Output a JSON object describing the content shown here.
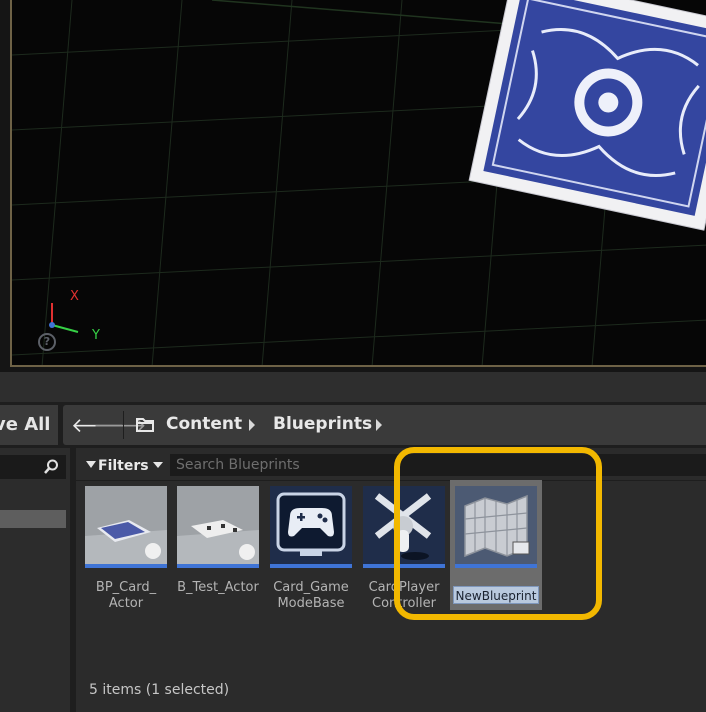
{
  "toolbar": {
    "save_all_label": "ve All"
  },
  "navigation": {
    "back_icon": "arrow-left-icon",
    "forward_icon": "arrow-right-icon",
    "breadcrumb": [
      "Content",
      "Blueprints"
    ]
  },
  "viewport": {
    "axis_x_label": "X",
    "axis_y_label": "Y",
    "help_icon": "?"
  },
  "content_browser": {
    "filters_label": "Filters",
    "search_placeholder": "Search Blueprints",
    "assets": [
      {
        "line1": "BP_Card_",
        "line2": "Actor"
      },
      {
        "line1": "B_Test_Actor",
        "line2": ""
      },
      {
        "line1": "Card_Game",
        "line2": "ModeBase"
      },
      {
        "line1": "CardPlayer",
        "line2": "Controller"
      },
      {
        "rename_value": "NewBlueprint",
        "selected": true
      }
    ],
    "status": "5 items (1 selected)"
  },
  "colors": {
    "highlight": "#f2b800",
    "asset_stripe": "#3f74d6",
    "axis_x": "#e03030",
    "axis_y": "#36d046"
  }
}
